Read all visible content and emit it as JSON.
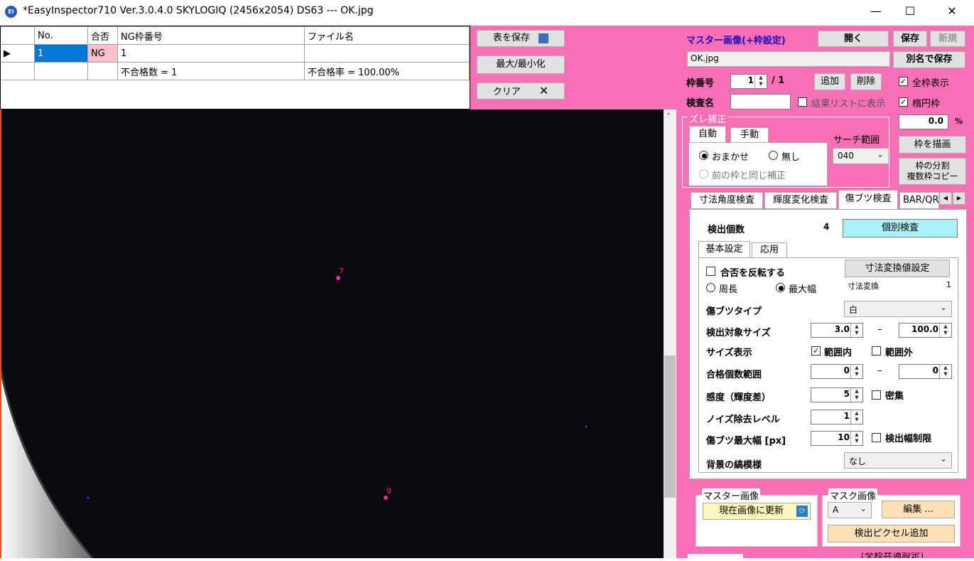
{
  "window": {
    "title": "*EasyInspector710 Ver.3.0.4.0 SKYLOGIQ (2456x2054) DS63 --- OK.jpg",
    "icon_text": "EI",
    "minimize": "—",
    "maximize": "☐",
    "close": "✕"
  },
  "results_table": {
    "headers": [
      "No.",
      "合否",
      "NG枠番号",
      "ファイル名"
    ],
    "row1": {
      "no": "1",
      "judge": "NG",
      "ng_frame": "1",
      "file": ""
    },
    "row2": {
      "fail_count": "不合格数 = 1",
      "fail_rate": "不合格率 = 100.00%"
    }
  },
  "mid_panel": {
    "save_table": "表を保存",
    "maxmin": "最大/最小化",
    "clear": "クリア"
  },
  "master": {
    "label": "マスター画像(+枠設定)",
    "open": "開く",
    "save": "保存",
    "new": "新規",
    "filename": "OK.jpg",
    "save_as": "別名で保存",
    "frame_no_label": "枠番号",
    "frame_no": "1",
    "frame_total": "/ 1",
    "add": "追加",
    "delete": "削除",
    "show_all": "全枠表示",
    "inspect_name_label": "検査名",
    "show_in_results": "結果リストに表示",
    "ellipse_frame": "楕円枠",
    "percent_value": "0.0",
    "percent_unit": "%"
  },
  "offset": {
    "title": "ズレ補正",
    "tab_auto": "自動",
    "tab_manual": "手動",
    "auto_option": "おまかせ",
    "none_option": "無し",
    "same_as_prev": "前の枠と同じ補正",
    "search_range_label": "サーチ範囲",
    "search_range": "040",
    "draw_frame": "枠を描画",
    "split_copy_1": "枠の分割",
    "split_copy_2": "複数枠コピー"
  },
  "inspection_tabs": [
    "寸法角度検査",
    "輝度変化検査",
    "傷ブツ検査",
    "BAR/QR"
  ],
  "defect": {
    "detect_count_label": "検出個数",
    "detect_count": "4",
    "individual": "個別検査",
    "tab_basic": "基本設定",
    "tab_adv": "応用",
    "invert": "合否を反転する",
    "dim_conv_setting": "寸法変換値設定",
    "perimeter": "周長",
    "max_width": "最大幅",
    "dim_conv_label": "寸法変換",
    "dim_conv_value": "1",
    "type_label": "傷ブツタイプ",
    "type_value": "白",
    "size_label": "検出対象サイズ",
    "size_min": "3.0",
    "size_max": "100.0",
    "dash": "–",
    "size_display_label": "サイズ表示",
    "in_range": "範囲内",
    "out_range": "範囲外",
    "pass_count_label": "合格個数範囲",
    "pass_min": "0",
    "pass_max": "0",
    "sens_label": "感度（輝度差）",
    "sens": "5",
    "dense": "密集",
    "noise_label": "ノイズ除去レベル",
    "noise": "1",
    "maxw_label": "傷ブツ最大幅 [px]",
    "maxw": "10",
    "width_limit": "検出幅制限",
    "bg_label": "背景の縞模様",
    "bg_value": "なし"
  },
  "bottom": {
    "master_image": "マスター画像",
    "update_current": "現在画像に更新",
    "mask_image": "マスク画像",
    "mask_value": "A",
    "edit": "編集 ...",
    "add_pixels": "検出ピクセル追加",
    "common_partial": "（全枠共通設定）"
  },
  "viewer": {
    "marker_7": "7",
    "marker_9": "9"
  }
}
